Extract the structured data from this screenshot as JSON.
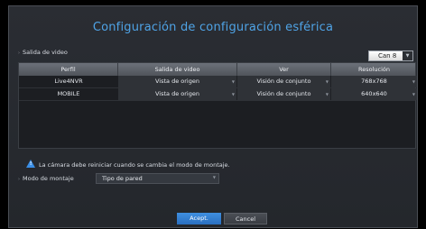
{
  "dialog": {
    "title": "Configuración de configuración esférica"
  },
  "video_output": {
    "label": "Salida de video",
    "channel": {
      "value": "Can 8"
    }
  },
  "table": {
    "headers": [
      "Perfil",
      "Salida de video",
      "Ver",
      "Resolución"
    ],
    "rows": [
      {
        "perfil": "Live4NVR",
        "salida": "Vista de origen",
        "ver": "Visión de conjunto",
        "resolucion": "768x768"
      },
      {
        "perfil": "MOBILE",
        "salida": "Vista de origen",
        "ver": "Visión de conjunto",
        "resolucion": "640x640"
      }
    ]
  },
  "warning": {
    "icon": "warning-icon",
    "text": "La cámara debe reiniciar cuando se cambia el modo de montaje."
  },
  "mount": {
    "label": "Modo de montaje",
    "value": "Tipo de pared"
  },
  "buttons": {
    "ok": "Acept.",
    "cancel": "Cancel"
  },
  "colors": {
    "title": "#4fa3e6",
    "accent": "#3a8ee6",
    "background": "#24272c"
  }
}
